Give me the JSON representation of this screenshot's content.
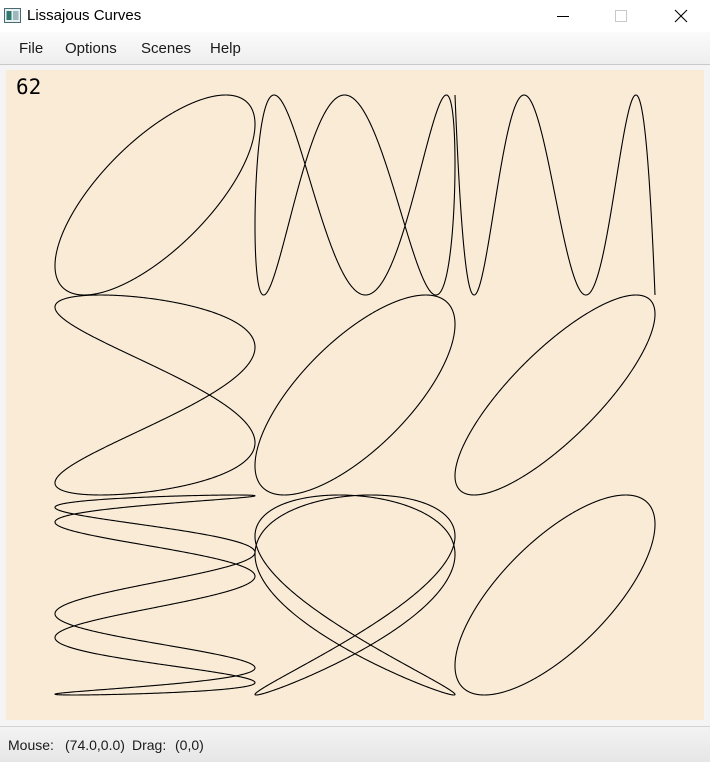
{
  "window": {
    "title": "Lissajous Curves",
    "icon": "lissajous-app-icon",
    "controls": [
      "minimize-icon",
      "maximize-icon",
      "close-icon"
    ]
  },
  "menu": [
    "File",
    "Options",
    "Scenes",
    "Help"
  ],
  "canvas": {
    "fps": "62",
    "background_color": "#faebd7",
    "curve_color": "#000000",
    "curves": [
      {
        "a": 1,
        "b": 1,
        "delta_deg": 45
      },
      {
        "a": 1,
        "b": 3,
        "delta_deg": 36
      },
      {
        "a": 1,
        "b": 5,
        "delta_deg": 36
      },
      {
        "a": 2,
        "b": 1,
        "delta_deg": 33
      },
      {
        "a": 1,
        "b": 1,
        "delta_deg": 45
      },
      {
        "a": 2,
        "b": 2,
        "delta_deg": 36
      },
      {
        "a": 5,
        "b": 1,
        "delta_deg": 36
      },
      {
        "a": 3,
        "b": 2,
        "delta_deg": 36
      },
      {
        "a": 1,
        "b": 1,
        "delta_deg": 45
      }
    ]
  },
  "status": {
    "mouse_label": "Mouse:",
    "mouse_value": "(74.0,0.0)",
    "drag_label": "Drag:",
    "drag_value": "(0,0)"
  }
}
